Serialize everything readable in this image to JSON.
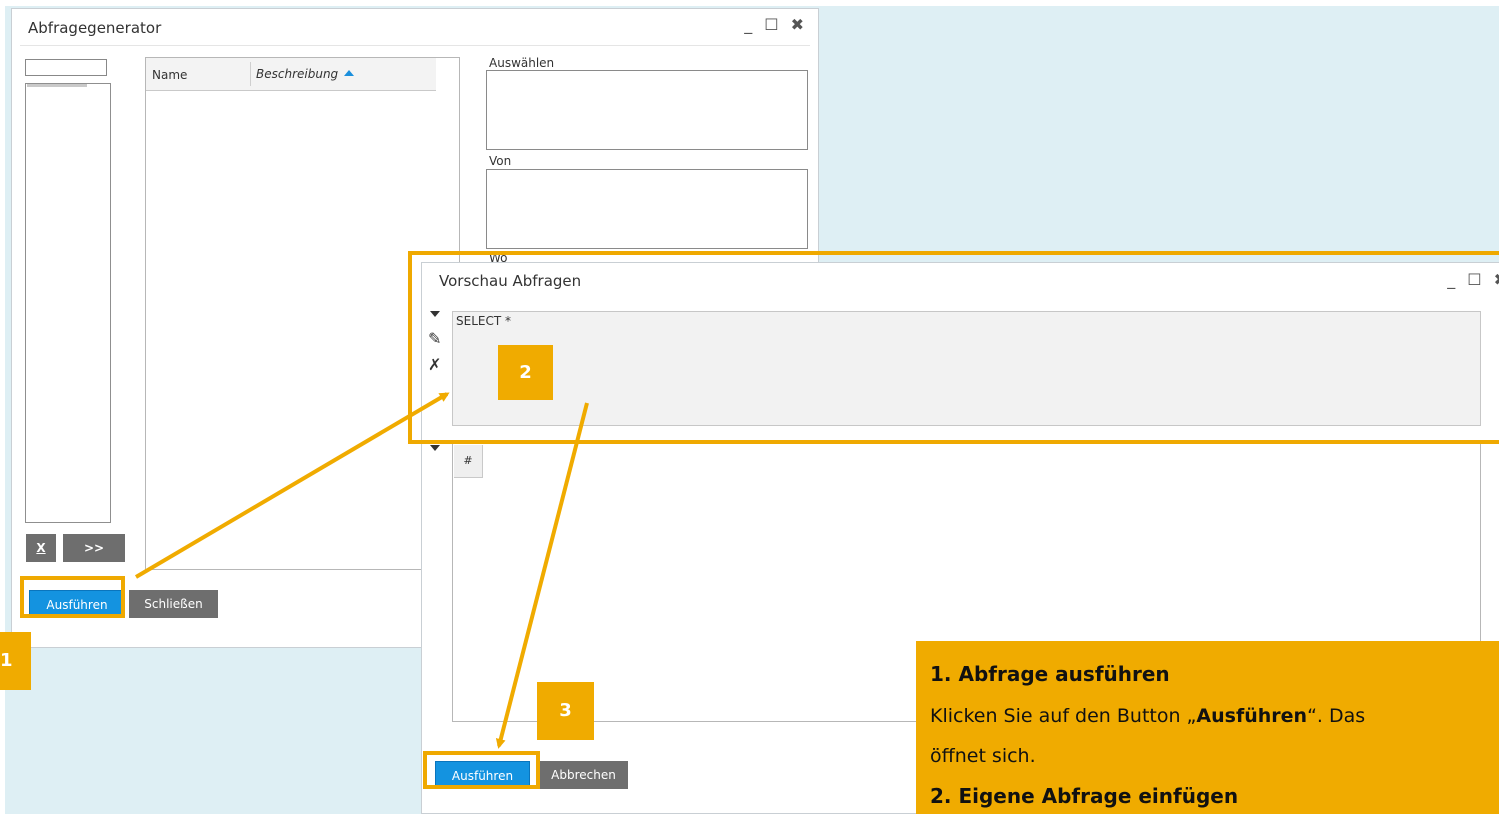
{
  "window1": {
    "title": "Abfragegenerator",
    "controls": {
      "minimize": "_",
      "maximize": "☐",
      "close": "✖"
    },
    "grid_columns": [
      "Name",
      "Beschreibung"
    ],
    "btn_remove": "X",
    "btn_move": ">>",
    "labels": {
      "select": "Auswählen",
      "from": "Von",
      "where": "Wo"
    },
    "btn_execute": "Ausführen",
    "btn_close": "Schließen"
  },
  "window2": {
    "title": "Vorschau Abfragen",
    "controls": {
      "minimize": "_",
      "maximize": "☐",
      "close": "✖"
    },
    "sql": "SELECT *",
    "hash_col": "#",
    "btn_execute": "Ausführen",
    "btn_cancel": "Abbrechen"
  },
  "badges": {
    "one": "1",
    "two": "2",
    "three": "3"
  },
  "note": {
    "heading": "1. Abfrage ausführen",
    "body_pre": "Klicken Sie auf den Button „",
    "body_bold": "Ausführen",
    "body_post": "“. Das",
    "body_line2": "öffnet sich.",
    "heading2": "2. Eigene Abfrage einfügen"
  },
  "colors": {
    "highlight": "#f0ab00",
    "button_blue": "#1493e0",
    "background": "#deeff4"
  }
}
